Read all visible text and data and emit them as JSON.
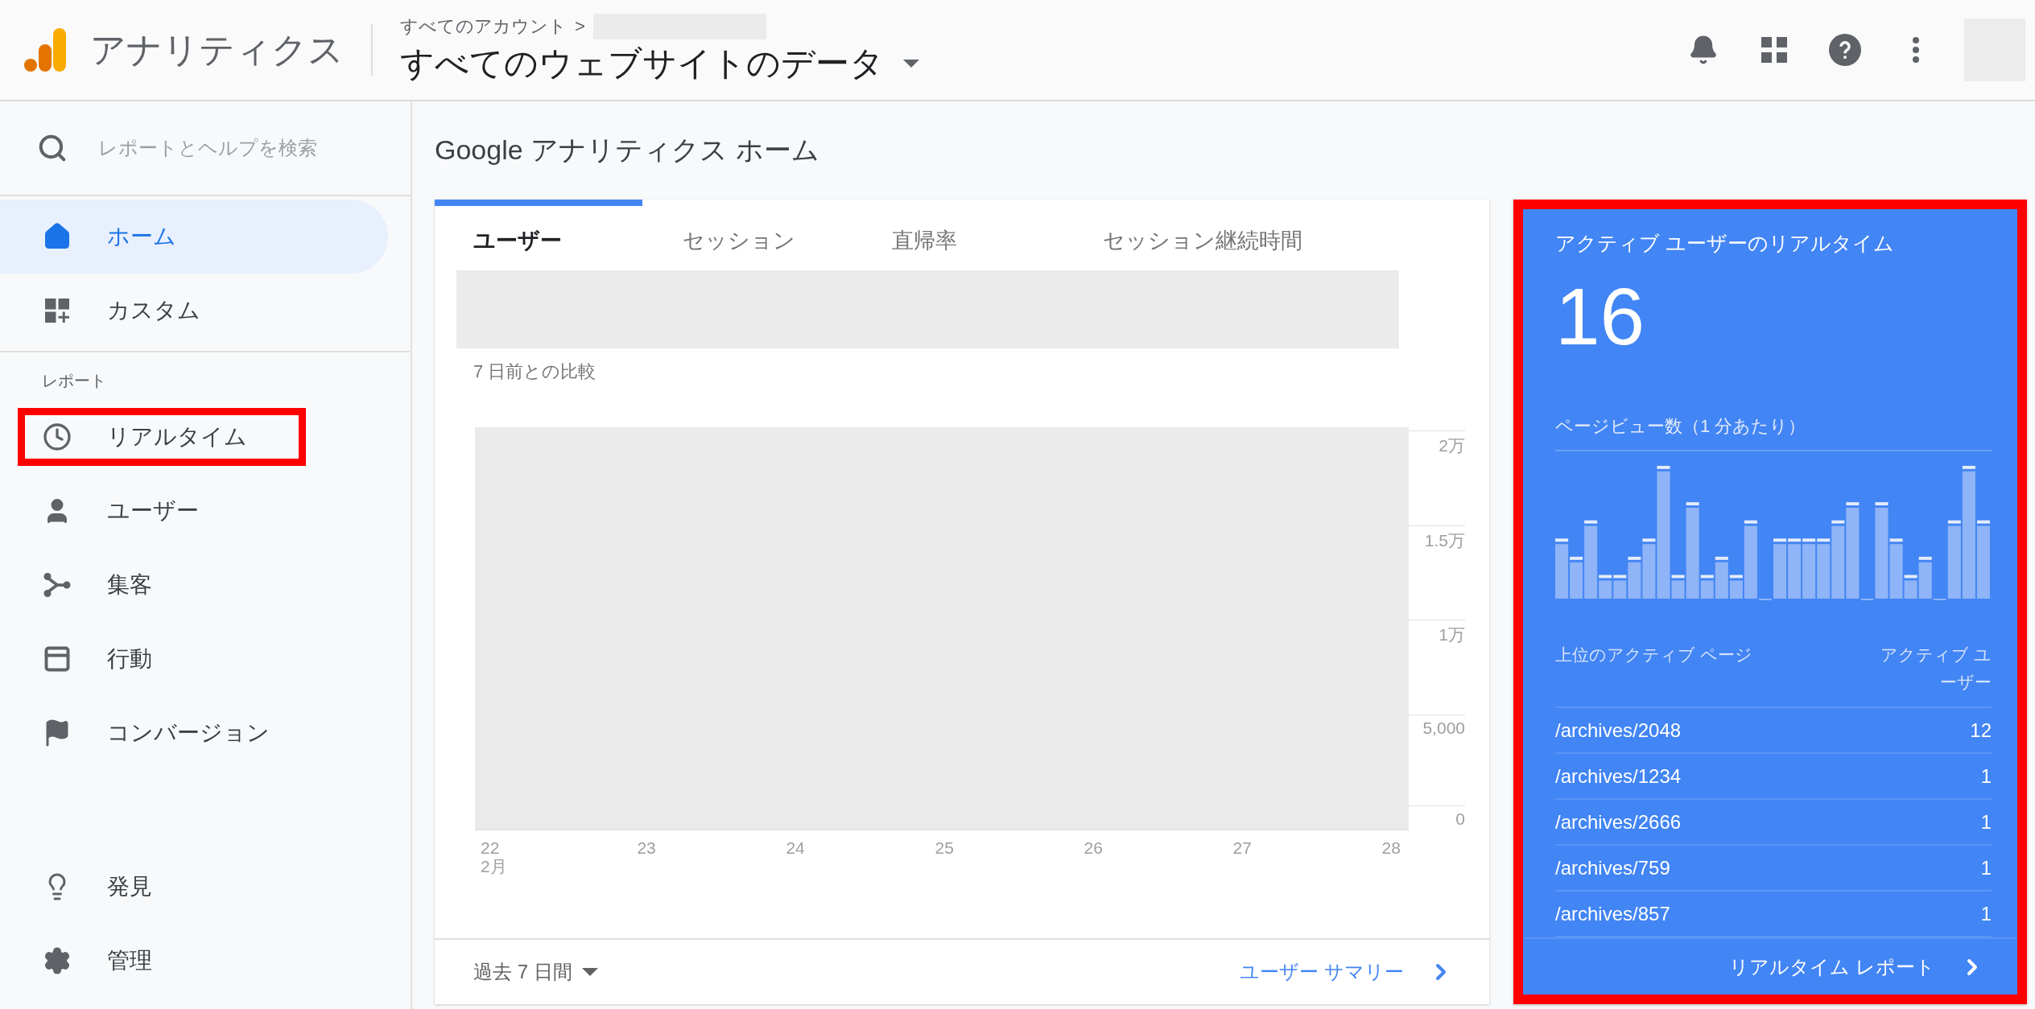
{
  "header": {
    "product": "アナリティクス",
    "breadcrumb": "すべてのアカウント",
    "breadcrumb_separator": ">",
    "view": "すべてのウェブサイトのデータ"
  },
  "sidebar": {
    "search": {
      "placeholder": "レポートとヘルプを検索"
    },
    "top_items": [
      {
        "kind": "home",
        "label": "ホーム",
        "selected": true,
        "highlighted": false
      },
      {
        "kind": "custom",
        "label": "カスタム",
        "selected": false,
        "highlighted": false
      }
    ],
    "section_label": "レポート",
    "report_items": [
      {
        "kind": "realtime",
        "label": "リアルタイム",
        "selected": false,
        "highlighted": true
      },
      {
        "kind": "user",
        "label": "ユーザー",
        "selected": false,
        "highlighted": false
      },
      {
        "kind": "acquisition",
        "label": "集客",
        "selected": false,
        "highlighted": false
      },
      {
        "kind": "behavior",
        "label": "行動",
        "selected": false,
        "highlighted": false
      },
      {
        "kind": "conversion",
        "label": "コンバージョン",
        "selected": false,
        "highlighted": false
      }
    ],
    "bottom_items": [
      {
        "kind": "discover",
        "label": "発見",
        "selected": false,
        "highlighted": false
      },
      {
        "kind": "admin",
        "label": "管理",
        "selected": false,
        "highlighted": false
      }
    ]
  },
  "page_title": "Google アナリティクス ホーム",
  "overview_card": {
    "tabs": [
      {
        "label": "ユーザー",
        "selected": true
      },
      {
        "label": "セッション",
        "selected": false
      },
      {
        "label": "直帰率",
        "selected": false
      },
      {
        "label": "セッション継続時間",
        "selected": false
      }
    ],
    "comparison": "7 日前との比較",
    "chart": {
      "yticks": [
        "2万",
        "1.5万",
        "1万",
        "5,000",
        "0"
      ],
      "xticks": [
        "22",
        "23",
        "24",
        "25",
        "26",
        "27",
        "28"
      ],
      "month": "2月"
    },
    "date_range": "過去 7 日間",
    "summary_link": "ユーザー サマリー"
  },
  "realtime_card": {
    "highlighted": true,
    "title": "アクティブ ユーザーのリアルタイム",
    "count": "16",
    "chart_label": "ページビュー数（1 分あたり）",
    "columns": [
      "上位のアクティブ ページ",
      "アクティブ ユーザー"
    ],
    "rows": [
      {
        "page": "/archives/2048",
        "users": "12"
      },
      {
        "page": "/archives/1234",
        "users": "1"
      },
      {
        "page": "/archives/2666",
        "users": "1"
      },
      {
        "page": "/archives/759",
        "users": "1"
      },
      {
        "page": "/archives/857",
        "users": "1"
      }
    ],
    "report_link": "リアルタイム レポート"
  }
}
